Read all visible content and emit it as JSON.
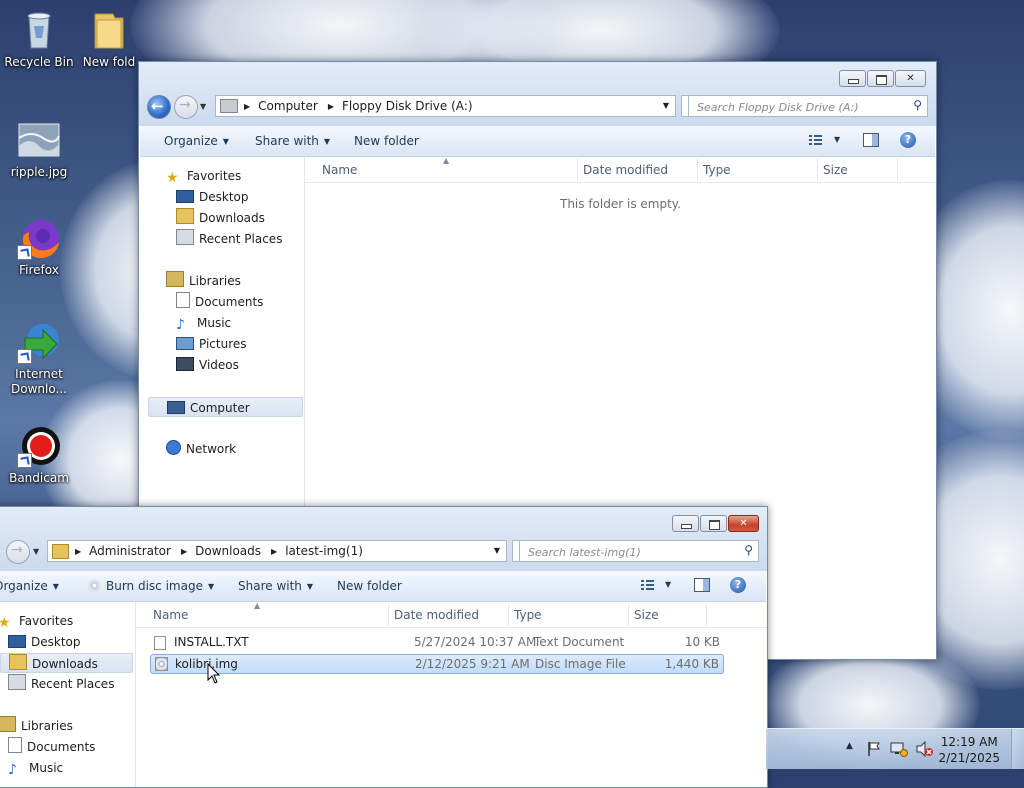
{
  "desktop": {
    "icons": [
      {
        "label": "Recycle Bin"
      },
      {
        "label": "New fold"
      },
      {
        "label": "ripple.jpg"
      },
      {
        "label": "Firefox"
      },
      {
        "label": "Internet Downlo..."
      },
      {
        "label": "Bandicam"
      }
    ]
  },
  "floppy_window": {
    "address": [
      "Computer",
      "Floppy Disk Drive (A:)"
    ],
    "search_placeholder": "Search Floppy Disk Drive (A:)",
    "commands": {
      "organize": "Organize",
      "share": "Share with",
      "new_folder": "New folder"
    },
    "nav": {
      "favorites": "Favorites",
      "favorites_items": [
        "Desktop",
        "Downloads",
        "Recent Places"
      ],
      "libraries": "Libraries",
      "libraries_items": [
        "Documents",
        "Music",
        "Pictures",
        "Videos"
      ],
      "computer": "Computer",
      "network": "Network"
    },
    "columns": [
      "Name",
      "Date modified",
      "Type",
      "Size"
    ],
    "empty_message": "This folder is empty."
  },
  "downloads_window": {
    "address": [
      "Administrator",
      "Downloads",
      "latest-img(1)"
    ],
    "search_placeholder": "Search latest-img(1)",
    "commands": {
      "organize": "Organize",
      "burn": "Burn disc image",
      "share": "Share with",
      "new_folder": "New folder"
    },
    "nav": {
      "favorites": "Favorites",
      "favorites_items": [
        "Desktop",
        "Downloads",
        "Recent Places"
      ],
      "libraries": "Libraries",
      "libraries_items": [
        "Documents",
        "Music"
      ]
    },
    "columns": [
      "Name",
      "Date modified",
      "Type",
      "Size"
    ],
    "files": [
      {
        "name": "INSTALL.TXT",
        "modified": "5/27/2024 10:37 AM",
        "type": "Text Document",
        "size": "10 KB"
      },
      {
        "name": "kolibri.img",
        "modified": "2/12/2025 9:21 AM",
        "type": "Disc Image File",
        "size": "1,440 KB"
      }
    ]
  },
  "taskbar": {
    "time": "12:19 AM",
    "date": "2/21/2025"
  },
  "colors": {
    "accent": "#3a78c7",
    "selection": "#c1dcfc",
    "close_red": "#c6402a"
  }
}
